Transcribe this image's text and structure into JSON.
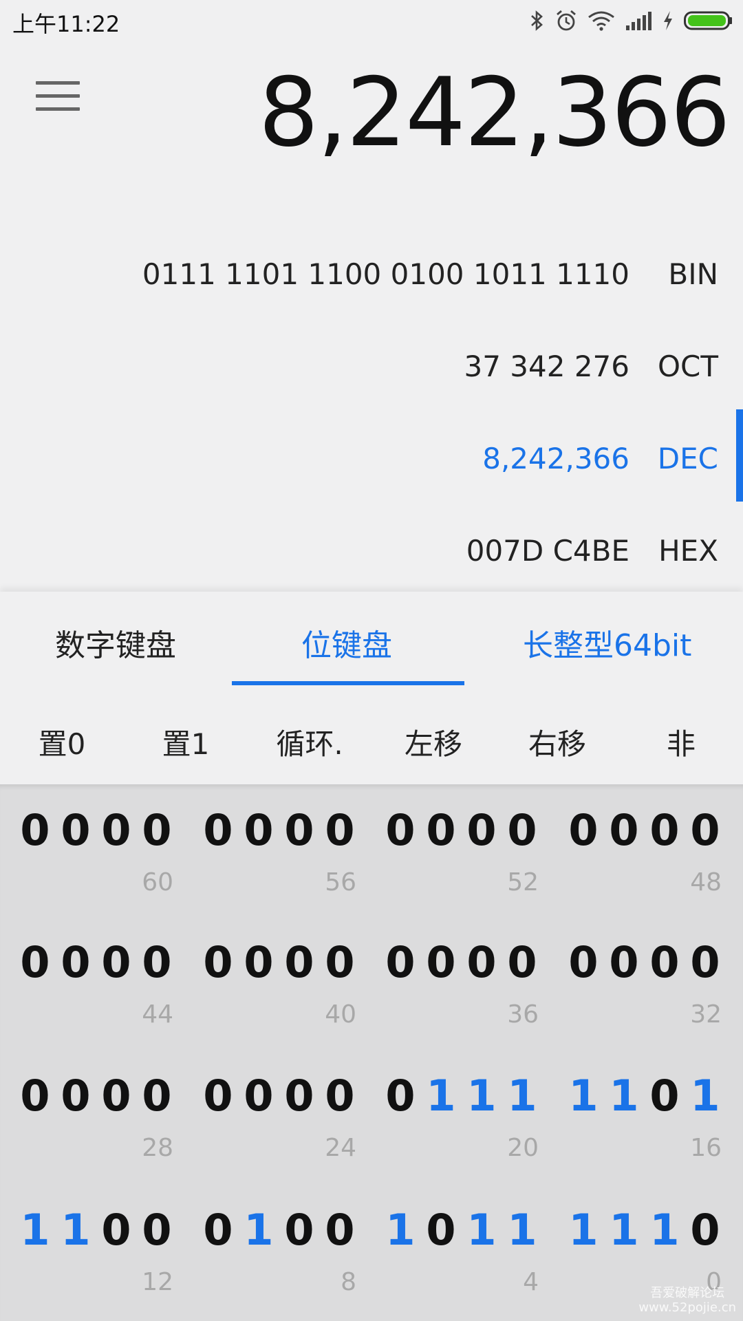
{
  "status_bar": {
    "time": "上午11:22",
    "icons": [
      "bluetooth-icon",
      "alarm-icon",
      "wifi-icon",
      "signal-icon",
      "charging-icon",
      "battery-icon"
    ],
    "battery_color": "#44c21a"
  },
  "display": {
    "value": "8,242,366"
  },
  "bases": [
    {
      "value": "0111 1101 1100 0100 1011 1110",
      "label": "BIN",
      "active": false
    },
    {
      "value": "37 342 276",
      "label": "OCT",
      "active": false
    },
    {
      "value": "8,242,366",
      "label": "DEC",
      "active": true
    },
    {
      "value": "007D C4BE",
      "label": "HEX",
      "active": false
    }
  ],
  "tabs": [
    {
      "label": "数字键盘",
      "selected": false
    },
    {
      "label": "位键盘",
      "selected": true
    },
    {
      "label": "长整型64bit",
      "selected": false
    }
  ],
  "ops": [
    "置0",
    "置1",
    "循环.",
    "左移",
    "右移",
    "非"
  ],
  "bit_rows": [
    {
      "bits": "0000000000000000",
      "indices": [
        "60",
        "56",
        "52",
        "48"
      ]
    },
    {
      "bits": "0000000000000000",
      "indices": [
        "44",
        "40",
        "36",
        "32"
      ]
    },
    {
      "bits": "0000000001111101",
      "indices": [
        "28",
        "24",
        "20",
        "16"
      ]
    },
    {
      "bits": "1100010010111110",
      "indices": [
        "12",
        "8",
        "4",
        "0"
      ]
    }
  ],
  "accent_color": "#1a73e8",
  "watermark": {
    "line1": "吾爱破解论坛",
    "line2": "www.52pojie.cn"
  }
}
